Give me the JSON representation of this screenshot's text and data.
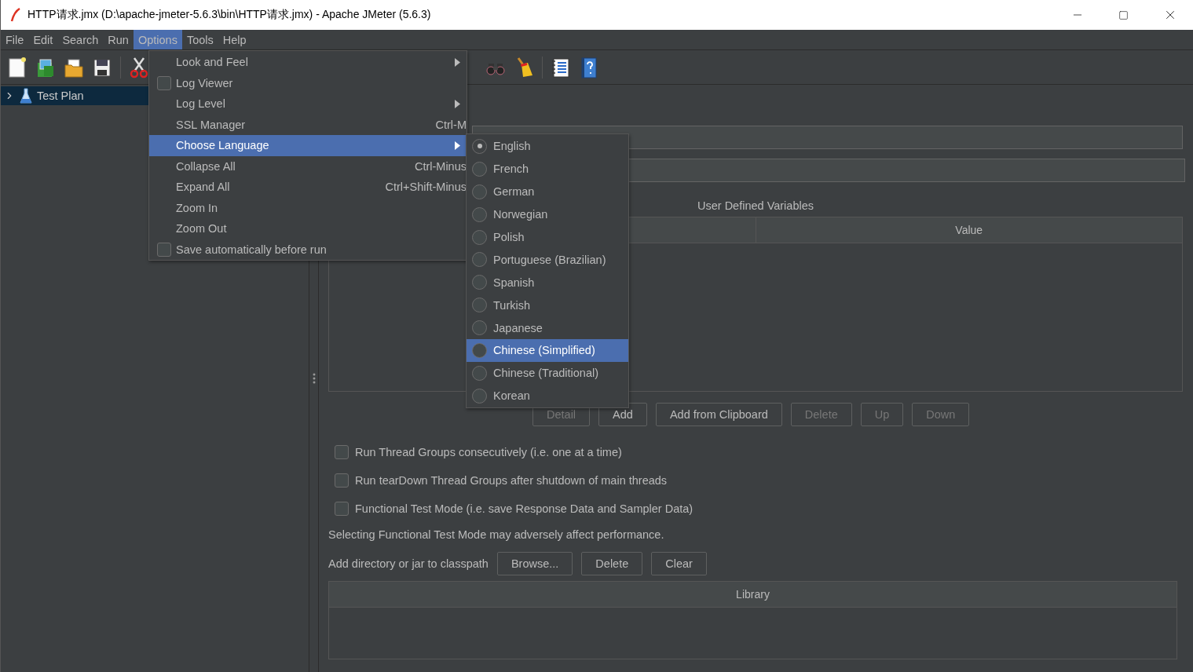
{
  "window": {
    "title": "HTTP请求.jmx (D:\\apache-jmeter-5.6.3\\bin\\HTTP请求.jmx) - Apache JMeter (5.6.3)"
  },
  "menu_bar": [
    {
      "label": "File",
      "selected": false
    },
    {
      "label": "Edit",
      "selected": false
    },
    {
      "label": "Search",
      "selected": false
    },
    {
      "label": "Run",
      "selected": false
    },
    {
      "label": "Options",
      "selected": true
    },
    {
      "label": "Tools",
      "selected": false
    },
    {
      "label": "Help",
      "selected": false
    }
  ],
  "tree": [
    {
      "label": "Test Plan",
      "selected": true,
      "expanded": false
    }
  ],
  "panel": {
    "variables_title": "User Defined Variables",
    "variables_columns": [
      "Value"
    ],
    "variable_buttons": [
      {
        "label": "Detail",
        "disabled": true
      },
      {
        "label": "Add",
        "disabled": false
      },
      {
        "label": "Add from Clipboard",
        "disabled": false
      },
      {
        "label": "Delete",
        "disabled": true
      },
      {
        "label": "Up",
        "disabled": true
      },
      {
        "label": "Down",
        "disabled": true
      }
    ],
    "options": [
      {
        "label": "Run Thread Groups consecutively (i.e. one at a time)",
        "checked": false
      },
      {
        "label": "Run tearDown Thread Groups after shutdown of main threads",
        "checked": false
      },
      {
        "label": "Functional Test Mode (i.e. save Response Data and Sampler Data)",
        "checked": false
      }
    ],
    "note": "Selecting Functional Test Mode may adversely affect performance.",
    "classpath_label": "Add directory or jar to classpath",
    "classpath_buttons": [
      {
        "label": "Browse...",
        "disabled": false
      },
      {
        "label": "Delete",
        "disabled": false
      },
      {
        "label": "Clear",
        "disabled": false
      }
    ],
    "library_columns": [
      "Library"
    ]
  },
  "options_menu": [
    {
      "kind": "submenu",
      "label": "Look and Feel",
      "selected": false
    },
    {
      "kind": "check",
      "label": "Log Viewer",
      "checked": false,
      "selected": false
    },
    {
      "kind": "submenu",
      "label": "Log Level",
      "selected": false
    },
    {
      "kind": "item",
      "label": "SSL Manager",
      "shortcut": "Ctrl-M",
      "selected": false
    },
    {
      "kind": "submenu",
      "label": "Choose Language",
      "selected": true
    },
    {
      "kind": "item",
      "label": "Collapse All",
      "shortcut": "Ctrl-Minus",
      "selected": false
    },
    {
      "kind": "item",
      "label": "Expand All",
      "shortcut": "Ctrl+Shift-Minus",
      "selected": false
    },
    {
      "kind": "item",
      "label": "Zoom In",
      "selected": false
    },
    {
      "kind": "item",
      "label": "Zoom Out",
      "selected": false
    },
    {
      "kind": "check",
      "label": "Save automatically before run",
      "checked": false,
      "selected": false
    }
  ],
  "language_menu": [
    {
      "label": "English",
      "checked": true,
      "selected": false
    },
    {
      "label": "French",
      "checked": false,
      "selected": false
    },
    {
      "label": "German",
      "checked": false,
      "selected": false
    },
    {
      "label": "Norwegian",
      "checked": false,
      "selected": false
    },
    {
      "label": "Polish",
      "checked": false,
      "selected": false
    },
    {
      "label": "Portuguese (Brazilian)",
      "checked": false,
      "selected": false
    },
    {
      "label": "Spanish",
      "checked": false,
      "selected": false
    },
    {
      "label": "Turkish",
      "checked": false,
      "selected": false
    },
    {
      "label": "Japanese",
      "checked": false,
      "selected": false
    },
    {
      "label": "Chinese (Simplified)",
      "checked": false,
      "selected": true
    },
    {
      "label": "Chinese (Traditional)",
      "checked": false,
      "selected": false
    },
    {
      "label": "Korean",
      "checked": false,
      "selected": false
    }
  ]
}
